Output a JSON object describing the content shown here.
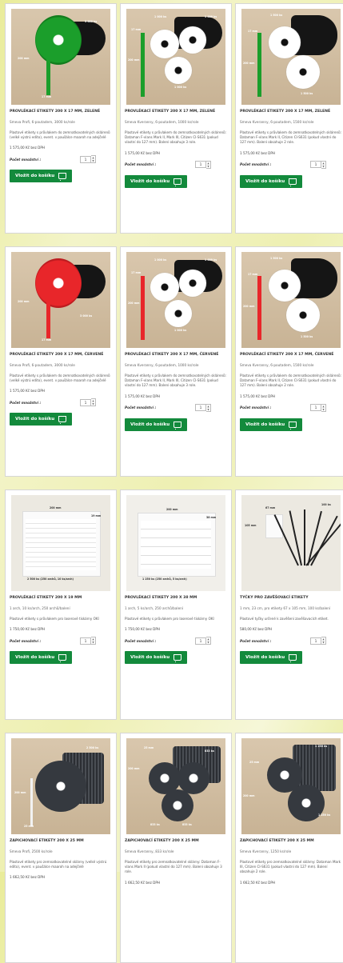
{
  "products": [
    {
      "title": "PROVLÉKACÍ ETIKETY 200 X 17 MM, ZELENÉ",
      "subtitle": "Smeva Profi, 6-poutadem, 3000 ks/role",
      "description": "Plastové etikety s průvlakem do zemnatkovatelných sklárenů (velké výstrú edito), event. v paušálce maaroh na adejčelé",
      "price": "1 575,00 Kč bez DPH",
      "qty_label": "Počet množství :",
      "qty": "1",
      "button": "Vložit do košíku",
      "image": "green-spool",
      "dims": [
        "200 mm",
        "17 mm",
        "3 000 ks"
      ]
    },
    {
      "title": "PROVLÉKACÍ ETIKETY 200 X 17 MM, ZELENÉ",
      "subtitle": "Smeva Kveranny, 6-poutadem, 1000 ks/role",
      "description": "Plastové etikety s průvlakem do zemnatkovatelných sklárenů: Dataman F-vlans Mark II, Mark III, Citizen CI-S631 (pokud vlastní do 127 mm). Balení obsahuje 3 role.",
      "price": "1 575,00 Kč bez DPH",
      "qty_label": "Počet množství :",
      "qty": "1",
      "button": "Vložit do košíku",
      "image": "three-white-rolls",
      "dims": [
        "1 000 ks",
        "17 mm",
        "200 mm",
        "1 000 ks",
        "1 000 ks"
      ]
    },
    {
      "title": "PROVLÉKACÍ ETIKETY 200 X 17 MM, ZELENÉ",
      "subtitle": "Smeva Kveranny, 6-poutadem, 1500 ks/role",
      "description": "Plastové etikety s průvlakem do zemnatkovatelných sklárenů: Dataman F-vlans Mark II, Citizen CI-S631 (pokud vlastní do 127 mm). Balení obsahuje 2 role.",
      "price": "1 575,00 Kč bez DPH",
      "qty_label": "Počet množství :",
      "qty": "1",
      "button": "Vložit do košíku",
      "image": "two-white-rolls",
      "dims": [
        "1 500 ks",
        "17 mm",
        "200 mm",
        "1 500 ks"
      ]
    },
    {
      "title": "PROVLÉKACÍ ETIKETY 200 X 17 MM, ČERVENÉ",
      "subtitle": "Smeva Profi, 6-poutadem, 3000 ks/role",
      "description": "Plastové etikety s průvlakem do zemnatkovatelných sklárenů (velké výstrú edito), event. v paušálce maaroh na adejčelé",
      "price": "1 575,00 Kč bez DPH",
      "qty_label": "Počet množství :",
      "qty": "1",
      "button": "Vložit do košíku",
      "image": "red-spool",
      "dims": [
        "200 mm",
        "17 mm",
        "3 000 ks"
      ]
    },
    {
      "title": "PROVLÉKACÍ ETIKETY 200 X 17 MM, ČERVENÉ",
      "subtitle": "Smeva Kveranny, 6-poutadem, 1000 ks/role",
      "description": "Plastové etikety s průvlakem do zemnatkovatelných sklárenů: Dataman F-vlans Mark II, Mark III, Citizen CI-S631 (pokud vlastní do 127 mm). Balení obsahuje 3 role.",
      "price": "1 575,00 Kč bez DPH",
      "qty_label": "Počet množství :",
      "qty": "1",
      "button": "Vložit do košíku",
      "image": "three-white-rolls-red",
      "dims": [
        "1 000 ks",
        "17 mm",
        "200 mm",
        "1 000 ks",
        "1 000 ks"
      ]
    },
    {
      "title": "PROVLÉKACÍ ETIKETY 200 X 17 MM, ČERVENÉ",
      "subtitle": "Smeva Kveranny, 6-poutadem, 1500 ks/role",
      "description": "Plastové etikety s průvlakem do zemnatkovatelných sklárenů: Dataman F-vlans Mark II, Citizen CI-S631 (pokud vlastní do 127 mm). Balení obsahuje 2 role.",
      "price": "1 575,00 Kč bez DPH",
      "qty_label": "Počet množství :",
      "qty": "1",
      "button": "Vložit do košíku",
      "image": "two-white-rolls-red",
      "dims": [
        "1 500 ks",
        "17 mm",
        "200 mm",
        "1 500 ks"
      ]
    },
    {
      "title": "PROVLÉKACÍ ETIKETY 200 X 19 MM",
      "subtitle": "1 arch, 10 ks/arch, 250 archů/balení",
      "description": "Plastové etikety s průvlakem pro laserové tiskárny OKI",
      "price": "1 750,00 Kč bez DPH",
      "qty_label": "Počet množství :",
      "qty": "1",
      "button": "Vložit do košíku",
      "image": "sheet-10",
      "dims": [
        "200 mm",
        "19 mm",
        "2 500 ks (250 archů, 10 ks/arch)"
      ]
    },
    {
      "title": "PROVLÉKACÍ ETIKETY 200 X 38 MM",
      "subtitle": "1 arch, 5 ks/arch, 250 archů/balení",
      "description": "Plastové etikety s průvlakem pro laserové tiskárny OKI",
      "price": "1 750,00 Kč bez DPH",
      "qty_label": "Počet množství :",
      "qty": "1",
      "button": "Vložit do košíku",
      "image": "sheet-5",
      "dims": [
        "200 mm",
        "38 mm",
        "1 250 ks (250 archů, 5 ks/arch)"
      ]
    },
    {
      "title": "TYČKY PRO ZAVĚŠOVACÍ ETIKETY",
      "subtitle": "1 mm, 23 cm, pro etikety 67 x 105 mm, 100 ks/balení",
      "description": "Plastové tyčky určené k zavěšení zavěšovacích etiket.",
      "price": "580,00 Kč bez DPH",
      "qty_label": "Počet množství :",
      "qty": "1",
      "button": "Vložit do košíku",
      "image": "ties",
      "dims": [
        "67 mm",
        "105 mm",
        "100 ks"
      ]
    },
    {
      "title": "ZAPICHOVACÍ ETIKETY 200 X 25 MM",
      "subtitle": "Smeva Profi, 2500 ks/role",
      "description": "Plastové etikety pro zemnatkovatelné sklárny (velké výstrú edito), event. v paušálce maaroh na adejčelé",
      "price": "1 662,50 Kč bez DPH",
      "qty_label": "Počet množství :",
      "qty": "1",
      "button": "Vložit do košíku",
      "image": "fabric-one",
      "dims": [
        "2 500 ks",
        "200 mm",
        "25 mm"
      ]
    },
    {
      "title": "ZAPICHOVACÍ ETIKETY 200 X 25 MM",
      "subtitle": "Smeva Kveranny, 833 ks/role",
      "description": "Plastové etikety pro zemnatkovatelné sklárny: Dataman F-vlans Mark II (pokud vlastní do 127 mm). Balení obsahuje 3 role.",
      "price": "1 662,50 Kč bez DPH",
      "qty_label": "Počet množství :",
      "qty": "1",
      "button": "Vložit do košíku",
      "image": "fabric-three",
      "dims": [
        "25 mm",
        "200 mm",
        "833 ks",
        "833 ks",
        "833 ks"
      ]
    },
    {
      "title": "ZAPICHOVACÍ ETIKETY 200 X 25 MM",
      "subtitle": "Smeva Kveranny, 1250 ks/role",
      "description": "Plastové etikety pro zemnatkovatelné sklárny: Dataman Mark III, Citizen CI-S631 (pokud vlastní do 127 mm). Balení obsahuje 2 role.",
      "price": "1 662,50 Kč bez DPH",
      "qty_label": "Počet množství :",
      "qty": "1",
      "button": "Vložit do košíku",
      "image": "fabric-two",
      "dims": [
        "1 250 ks",
        "25 mm",
        "200 mm",
        "1 250 ks"
      ]
    }
  ]
}
